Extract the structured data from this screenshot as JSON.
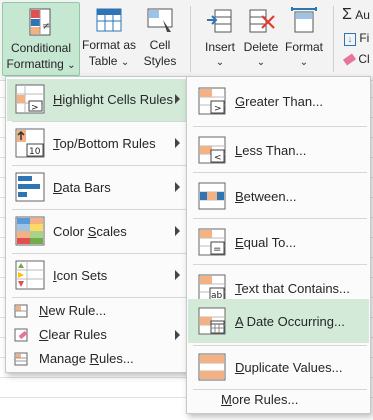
{
  "ribbon": {
    "conditional_formatting": {
      "line1": "Conditional",
      "line2": "Formatting",
      "chevron": "⌄"
    },
    "format_as_table": {
      "line1": "Format as",
      "line2": "Table"
    },
    "cell_styles": {
      "line1": "Cell",
      "line2": "Styles"
    },
    "insert": {
      "label": "Insert"
    },
    "delete": {
      "label": "Delete"
    },
    "format": {
      "label": "Format"
    },
    "editing": {
      "autosum": "Au",
      "fill": "Fi",
      "clear": "Cl"
    }
  },
  "main_menu": {
    "items": [
      {
        "label": "Highlight Cells Rules",
        "icon": "highlight-cells-icon",
        "has_submenu": true,
        "highlighted": true
      },
      {
        "label": "Top/Bottom Rules",
        "icon": "top-bottom-icon",
        "has_submenu": true
      },
      {
        "label": "Data Bars",
        "icon": "data-bars-icon",
        "has_submenu": true
      },
      {
        "label": "Color Scales",
        "icon": "color-scales-icon",
        "has_submenu": true
      },
      {
        "label": "Icon Sets",
        "icon": "icon-sets-icon",
        "has_submenu": true
      }
    ],
    "small_items": [
      {
        "label": "New Rule...",
        "icon": "new-rule-icon"
      },
      {
        "label": "Clear Rules",
        "icon": "clear-rules-icon",
        "has_submenu": true
      },
      {
        "label": "Manage Rules...",
        "icon": "manage-rules-icon"
      }
    ]
  },
  "submenu": {
    "items": [
      {
        "label": "Greater Than...",
        "icon": "greater-than-icon"
      },
      {
        "label": "Less Than...",
        "icon": "less-than-icon"
      },
      {
        "label": "Between...",
        "icon": "between-icon"
      },
      {
        "label": "Equal To...",
        "icon": "equal-to-icon"
      },
      {
        "label": "Text that Contains...",
        "icon": "text-contains-icon"
      },
      {
        "label": "A Date Occurring...",
        "icon": "date-occurring-icon",
        "highlighted": true
      },
      {
        "label": "Duplicate Values...",
        "icon": "duplicate-values-icon"
      }
    ],
    "more_rules": "More Rules..."
  },
  "colors": {
    "accent": "#c6e7d2",
    "highlight": "#d3ead9",
    "orange": "#f4b183",
    "blue": "#2e75b6"
  }
}
